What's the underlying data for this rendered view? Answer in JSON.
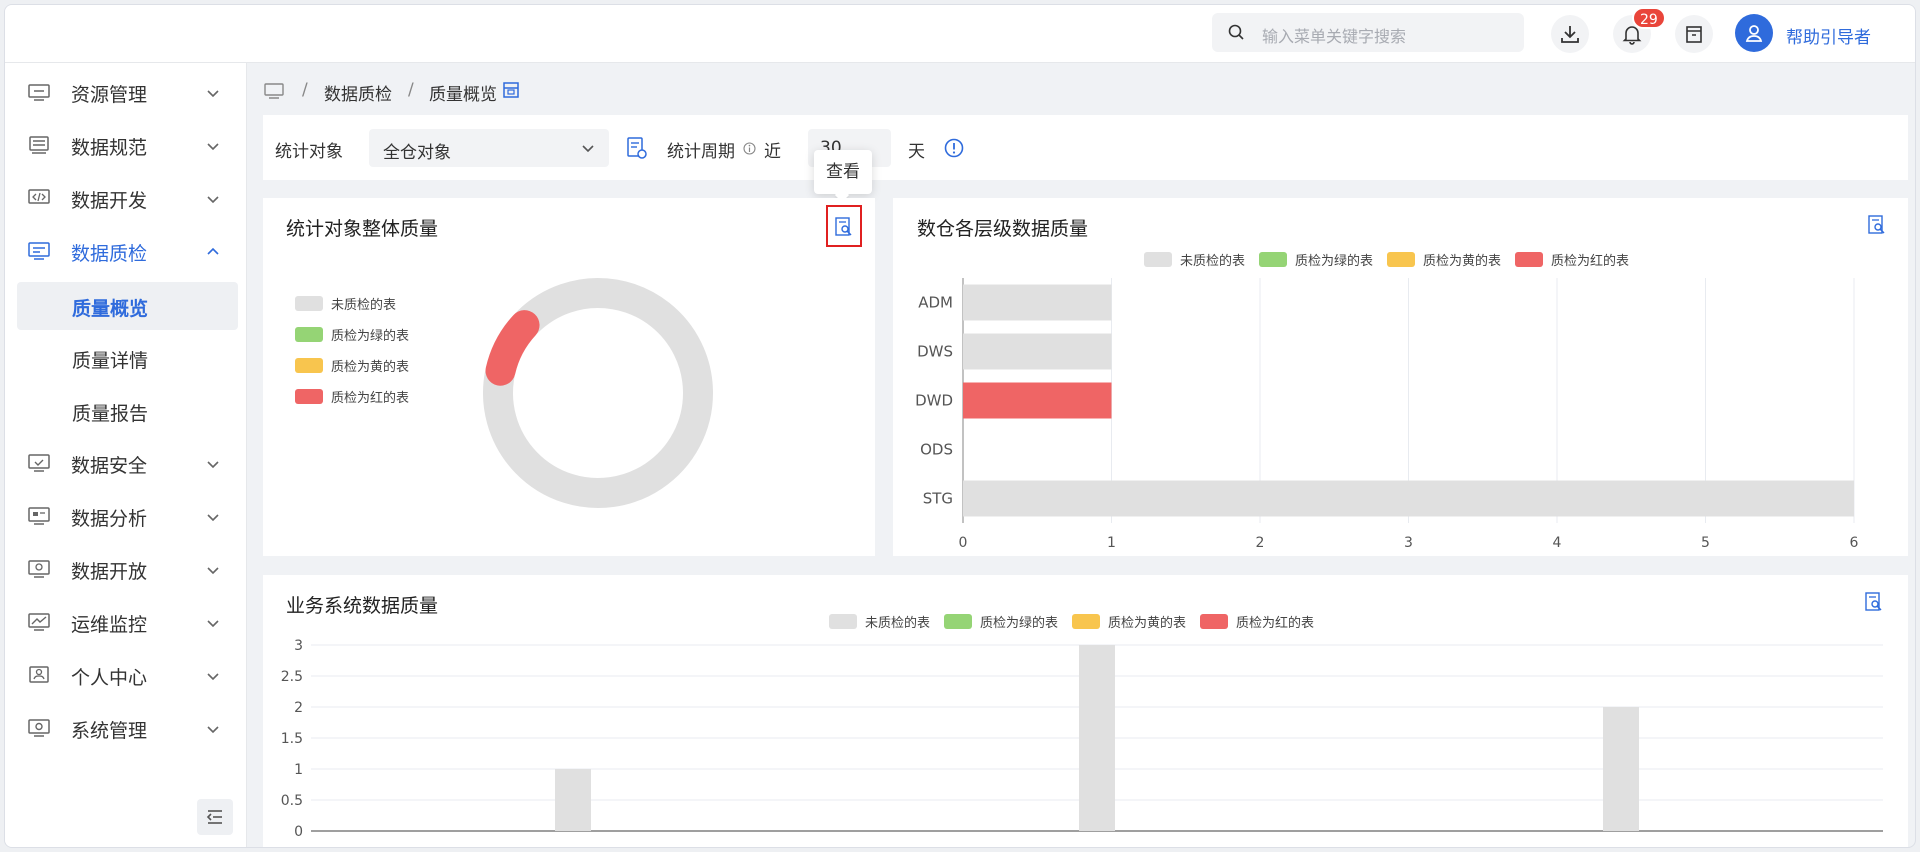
{
  "header": {
    "search_placeholder": "输入菜单关键字搜索",
    "notification_count": "29",
    "help_label": "帮助引导者"
  },
  "sidebar": {
    "items": [
      {
        "label": "资源管理",
        "icon": "server-icon"
      },
      {
        "label": "数据规范",
        "icon": "database-icon"
      },
      {
        "label": "数据开发",
        "icon": "code-icon"
      },
      {
        "label": "数据质检",
        "icon": "monitor-icon",
        "expanded": true
      },
      {
        "label": "数据安全",
        "icon": "shield-monitor-icon"
      },
      {
        "label": "数据分析",
        "icon": "chart-icon"
      },
      {
        "label": "数据开放",
        "icon": "share-icon"
      },
      {
        "label": "运维监控",
        "icon": "trend-icon"
      },
      {
        "label": "个人中心",
        "icon": "user-icon"
      },
      {
        "label": "系统管理",
        "icon": "settings-icon"
      }
    ],
    "subitems": [
      {
        "label": "质量概览",
        "selected": true
      },
      {
        "label": "质量详情"
      },
      {
        "label": "质量报告"
      }
    ]
  },
  "breadcrumb": {
    "sep": "/",
    "level1": "数据质检",
    "level2": "质量概览"
  },
  "filters": {
    "target_label": "统计对象",
    "target_value": "全仓对象",
    "period_label": "统计周期",
    "near_label": "近",
    "period_value": "30",
    "day_label": "天"
  },
  "tooltip": {
    "text": "查看"
  },
  "colors": {
    "unchecked": "#e0e0e0",
    "green": "#95d475",
    "yellow": "#f8c54e",
    "red": "#ef6565",
    "accent": "#2f6bdc"
  },
  "legend": [
    "未质检的表",
    "质检为绿的表",
    "质检为黄的表",
    "质检为红的表"
  ],
  "chart_data": [
    {
      "type": "pie",
      "title": "统计对象整体质量",
      "labels": [
        "未质检的表",
        "质检为绿的表",
        "质检为黄的表",
        "质检为红的表"
      ],
      "values": [
        10,
        0,
        0,
        1
      ]
    },
    {
      "type": "bar",
      "orientation": "horizontal",
      "title": "数仓各层级数据质量",
      "categories": [
        "ADM",
        "DWS",
        "DWD",
        "ODS",
        "STG"
      ],
      "series": [
        {
          "name": "未质检的表",
          "values": [
            1,
            1,
            0,
            0,
            6
          ]
        },
        {
          "name": "质检为绿的表",
          "values": [
            0,
            0,
            0,
            0,
            0
          ]
        },
        {
          "name": "质检为黄的表",
          "values": [
            0,
            0,
            0,
            0,
            0
          ]
        },
        {
          "name": "质检为红的表",
          "values": [
            0,
            0,
            1,
            0,
            0
          ]
        }
      ],
      "xlim": [
        0,
        6
      ],
      "xticks": [
        "0",
        "1",
        "2",
        "3",
        "4",
        "5",
        "6"
      ],
      "grid": true,
      "legend_position": "top"
    },
    {
      "type": "bar",
      "title": "业务系统数据质量",
      "series": [
        {
          "name": "未质检的表",
          "values": [
            1,
            3,
            2
          ]
        },
        {
          "name": "质检为绿的表",
          "values": [
            0,
            0,
            0
          ]
        },
        {
          "name": "质检为黄的表",
          "values": [
            0,
            0,
            0
          ]
        },
        {
          "name": "质检为红的表",
          "values": [
            0,
            0,
            0
          ]
        }
      ],
      "ylim": [
        0,
        3
      ],
      "yticks": [
        "0",
        "0.5",
        "1",
        "1.5",
        "2",
        "2.5",
        "3"
      ],
      "grid": true,
      "legend_position": "top"
    }
  ]
}
